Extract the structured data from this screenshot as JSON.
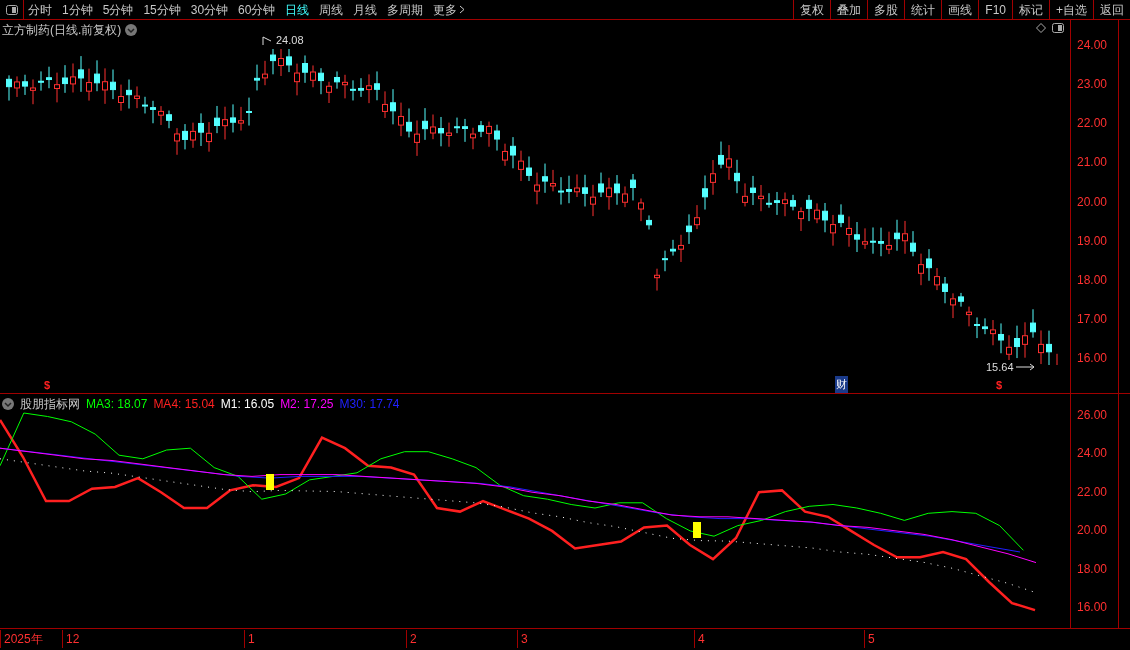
{
  "toolbar": {
    "periods": [
      {
        "label": "分时",
        "selected": false
      },
      {
        "label": "1分钟",
        "selected": false
      },
      {
        "label": "5分钟",
        "selected": false
      },
      {
        "label": "15分钟",
        "selected": false
      },
      {
        "label": "30分钟",
        "selected": false
      },
      {
        "label": "60分钟",
        "selected": false
      },
      {
        "label": "日线",
        "selected": true
      },
      {
        "label": "周线",
        "selected": false
      },
      {
        "label": "月线",
        "selected": false
      },
      {
        "label": "多周期",
        "selected": false
      }
    ],
    "more": "更多",
    "buttons": [
      "复权",
      "叠加",
      "多股",
      "统计",
      "画线",
      "F10",
      "标记",
      "+自选",
      "返回"
    ]
  },
  "main_chart": {
    "title": "立方制药(日线.前复权)",
    "high_label": "24.08",
    "low_label": "15.64",
    "y_labels": [
      "24.00",
      "23.00",
      "22.00",
      "21.00",
      "20.00",
      "19.00",
      "18.00",
      "17.00",
      "16.00"
    ],
    "markers": [
      {
        "kind": "dollar",
        "text": "$"
      },
      {
        "kind": "finance",
        "text": "财"
      },
      {
        "kind": "dollar",
        "text": "$"
      }
    ]
  },
  "indicator": {
    "name": "股朋指标网",
    "legend": [
      {
        "label": "MA3: 18.07",
        "color": "#00ff00"
      },
      {
        "label": "MA4: 15.04",
        "color": "#ff2020"
      },
      {
        "label": "M1: 16.05",
        "color": "#ffffff"
      },
      {
        "label": "M2: 17.25",
        "color": "#ff00ff"
      },
      {
        "label": "M30: 17.74",
        "color": "#2020ff"
      }
    ],
    "y_labels": [
      "26.00",
      "24.00",
      "22.00",
      "20.00",
      "18.00",
      "16.00"
    ]
  },
  "date_axis": [
    "2025年",
    "12",
    "1",
    "2",
    "3",
    "4",
    "5"
  ]
}
